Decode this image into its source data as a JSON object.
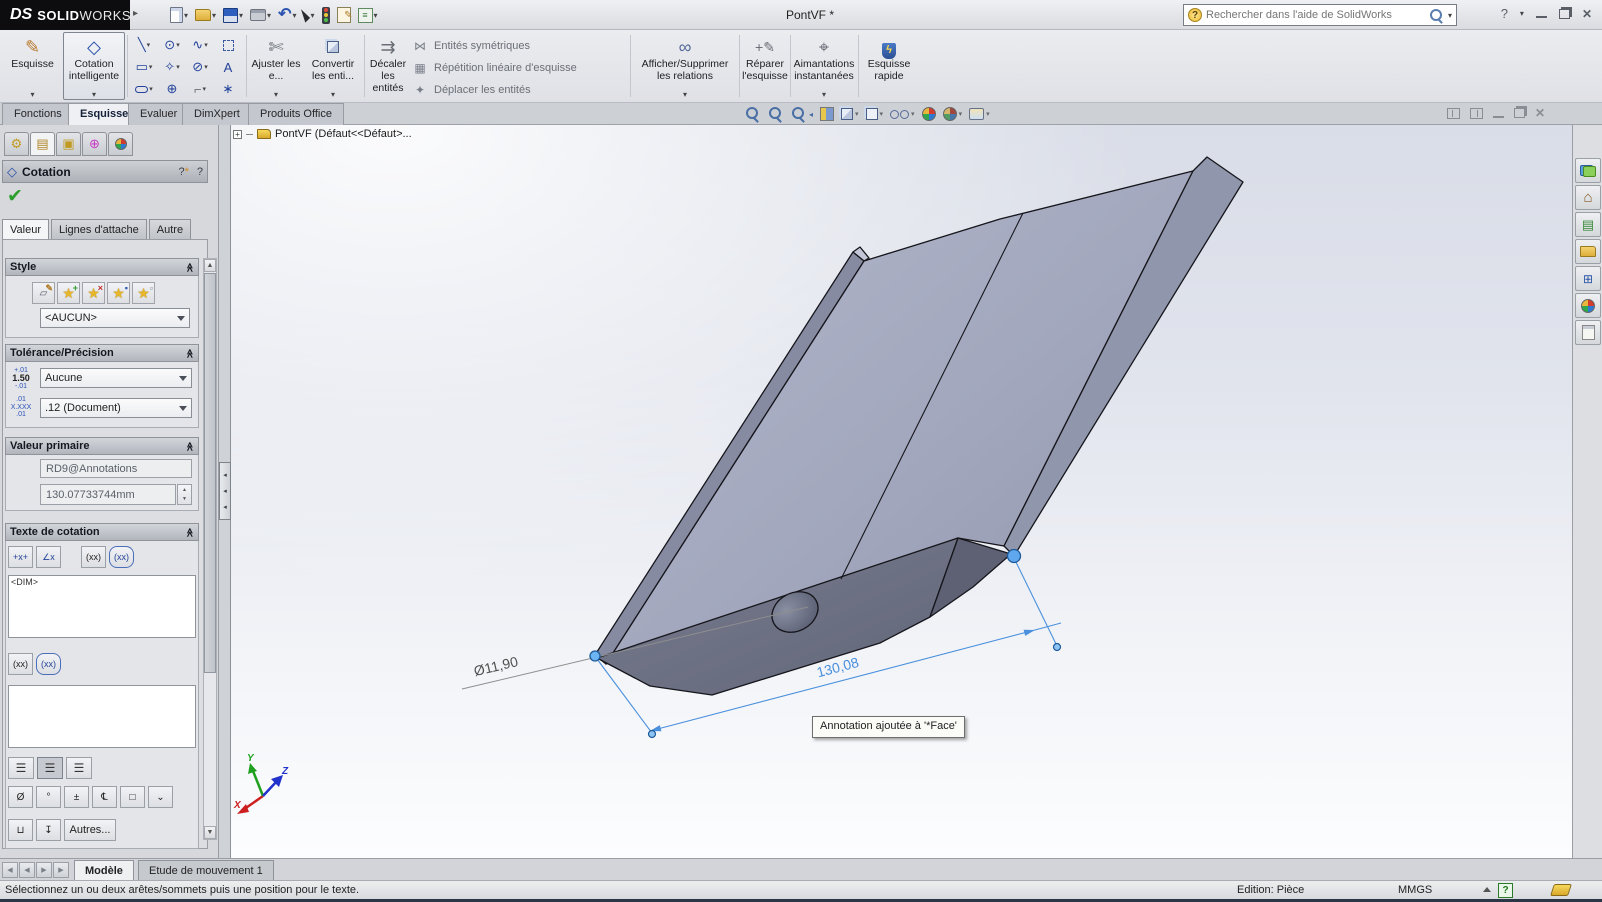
{
  "window": {
    "logo_prefix": "DS",
    "logo_solid": "SOLID",
    "logo_works": "WORKS",
    "title": "PontVF *",
    "search_placeholder": "Rechercher dans l'aide de SolidWorks",
    "help_glyph": "?"
  },
  "icons": {
    "menu_expand": "▸",
    "caret": "▾",
    "undo": "↶",
    "line": "╲",
    "circle": "⊙",
    "spline": "∿",
    "rectangle": "▭",
    "polygon_star": "✧",
    "ellipse": "⊘",
    "text_tool": "A",
    "hexagon": "⊕",
    "fillet": "⌐",
    "point": "∗",
    "trim": "✄",
    "offset": "⇉",
    "mirror": "⋈",
    "pattern": "▦",
    "move": "✦",
    "relations": "∞",
    "pencil": "✎",
    "diamond": "◇",
    "snap_target": "⌖",
    "bolt": "ϟ",
    "plus": "+",
    "gear": "⚙",
    "form": "▤",
    "stack": "▣",
    "target": "⊕",
    "home": "⌂",
    "check": "✔",
    "chevrons": "≪",
    "up": "▲",
    "down": "▼",
    "left_tri": "◀",
    "right_tri": "▶",
    "small_left": "◂",
    "align_bars": "☰",
    "dd_chevron": "⌄"
  },
  "ribbon": {
    "esquisse": "Esquisse",
    "cotation": "Cotation intelligente",
    "ajuster": "Ajuster les e...",
    "convertir": "Convertir les enti...",
    "decaler": "Décaler les entités",
    "entites_symetriques": "Entités symétriques",
    "repetition_lineaire": "Répétition linéaire d'esquisse",
    "deplacer": "Déplacer les entités",
    "afficher_supprimer": "Afficher/Supprimer les relations",
    "reparer": "Réparer l'esquisse",
    "aimantations": "Aimantations instantanées",
    "esquisse_rapide": "Esquisse rapide"
  },
  "command_tabs": {
    "items": [
      {
        "label": "Fonctions"
      },
      {
        "label": "Esquisse"
      },
      {
        "label": "Evaluer"
      },
      {
        "label": "DimXpert"
      },
      {
        "label": "Produits Office"
      }
    ]
  },
  "feature_tree": {
    "root": "PontVF  (Défaut<<Défaut>..."
  },
  "property_manager": {
    "title": "Cotation",
    "tabs": [
      {
        "label": "Valeur"
      },
      {
        "label": "Lignes d'attache"
      },
      {
        "label": "Autre"
      }
    ],
    "style": {
      "header": "Style",
      "value": "<AUCUN>"
    },
    "tolerance": {
      "header": "Tolérance/Précision",
      "tol_top": "+.01",
      "tol_mid": "1.50",
      "tol_bot": "-.01",
      "tol_value": "Aucune",
      "prec_top": ".01",
      "prec_mid": "X.XXX",
      "prec_bot": ".01",
      "prec_value": ".12 (Document)"
    },
    "primary": {
      "header": "Valeur primaire",
      "name": "RD9@Annotations",
      "value": "130.07733744mm"
    },
    "dim_text": {
      "header": "Texte de cotation",
      "content": "<DIM>",
      "btn_xx": "(xx)",
      "btn_offset_x": "+x+",
      "btn_angle_x": "∠x",
      "more": "Autres...",
      "sym_diameter": "Ø",
      "sym_degree": "°",
      "sym_plusminus": "±",
      "sym_centerline": "℄",
      "sym_square": "□",
      "sym_bracket": "⊔",
      "sym_arrow_down": "↧"
    }
  },
  "viewport": {
    "dim_diameter": "Ø11,90",
    "dim_length": "130,08",
    "tooltip": "Annotation ajoutée à '*Face'",
    "triad_x": "X",
    "triad_y": "Y",
    "triad_z": "Z"
  },
  "bottom_bar": {
    "tabs": [
      {
        "label": "Modèle"
      },
      {
        "label": "Etude de mouvement 1"
      }
    ]
  },
  "status_bar": {
    "message": "Sélectionnez un ou deux arêtes/sommets puis une position pour le texte.",
    "edition": "Edition: Pièce",
    "units": "MMGS"
  }
}
